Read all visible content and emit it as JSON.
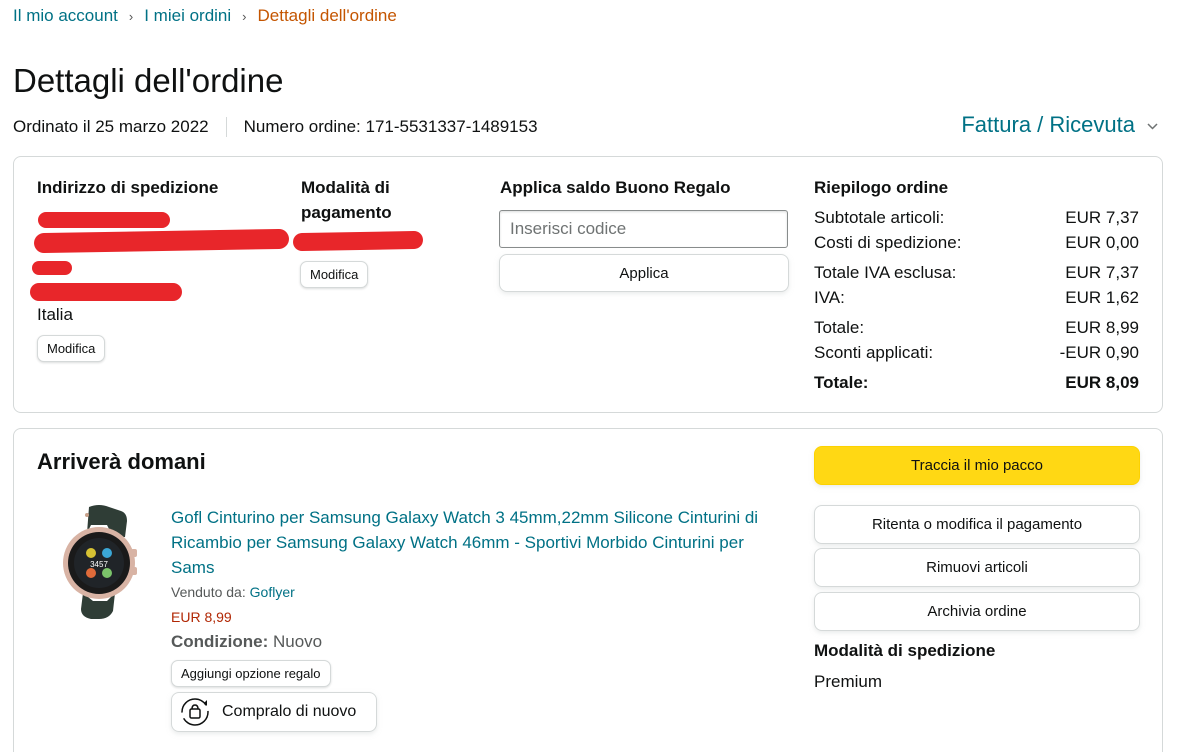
{
  "breadcrumb": {
    "items": [
      "Il mio account",
      "I miei ordini"
    ],
    "current": "Dettagli dell'ordine",
    "separator": "›"
  },
  "page": {
    "title": "Dettagli dell'ordine",
    "ordered_on": "Ordinato il 25 marzo 2022",
    "order_number": "Numero ordine: 171-5531337-1489153",
    "invoice_link": "Fattura / Ricevuta"
  },
  "shipping_address": {
    "title": "Indirizzo di spedizione",
    "country": "Italia",
    "edit_label": "Modifica"
  },
  "payment": {
    "title": "Modalità di pagamento",
    "edit_label": "Modifica"
  },
  "gift": {
    "title": "Applica saldo Buono Regalo",
    "placeholder": "Inserisci codice",
    "apply_label": "Applica"
  },
  "summary": {
    "title": "Riepilogo ordine",
    "rows": [
      {
        "label": "Subtotale articoli:",
        "value": "EUR 7,37"
      },
      {
        "label": "Costi di spedizione:",
        "value": "EUR 0,00"
      },
      {
        "label": "Totale IVA esclusa:",
        "value": "EUR 7,37"
      },
      {
        "label": "IVA:",
        "value": "EUR 1,62"
      },
      {
        "label": "Totale:",
        "value": "EUR 8,99"
      },
      {
        "label": "Sconti applicati:",
        "value": "-EUR 0,90"
      }
    ],
    "grand_total_label": "Totale:",
    "grand_total_value": "EUR 8,09"
  },
  "shipment": {
    "title": "Arriverà domani",
    "product_title": "Gofl Cinturino per Samsung Galaxy Watch 3 45mm,22mm Silicone Cinturini di Ricambio per Samsung Galaxy Watch 46mm - Sportivi Morbido Cinturini per Sams",
    "sold_by_label": "Venduto da:",
    "seller": "Goflyer",
    "price": "EUR 8,99",
    "condition_label": "Condizione:",
    "condition_value": "Nuovo",
    "gift_option_label": "Aggiungi opzione regalo",
    "buy_again_label": "Compralo di nuovo",
    "watch_face_text": "3457"
  },
  "actions": {
    "track": "Traccia il mio pacco",
    "retry_payment": "Ritenta o modifica il pagamento",
    "remove_items": "Rimuovi articoli",
    "archive": "Archivia ordine"
  },
  "shipping_mode": {
    "title": "Modalità di spedizione",
    "value": "Premium"
  },
  "colors": {
    "link": "#007185",
    "current_breadcrumb": "#c45500",
    "price": "#b12704",
    "primary_button": "#ffd814",
    "redaction": "#e8262a"
  }
}
